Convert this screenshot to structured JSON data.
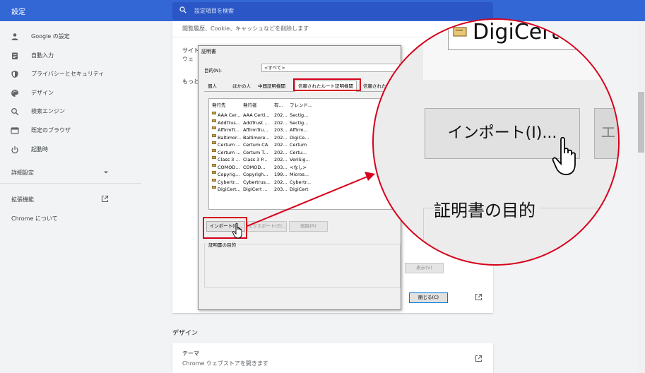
{
  "header": {
    "title": "設定",
    "search_placeholder": "設定項目を検索"
  },
  "sidebar": {
    "items": [
      {
        "icon": "person-icon",
        "label": "Google の設定"
      },
      {
        "icon": "assignment-icon",
        "label": "自動入力"
      },
      {
        "icon": "shield-icon",
        "label": "プライバシーとセキュリティ"
      },
      {
        "icon": "palette-icon",
        "label": "デザイン"
      },
      {
        "icon": "search-icon",
        "label": "検索エンジン"
      },
      {
        "icon": "browser-icon",
        "label": "既定のブラウザ"
      },
      {
        "icon": "power-icon",
        "label": "起動時"
      }
    ],
    "advanced": "詳細設定",
    "extensions": "拡張機能",
    "about": "Chrome について"
  },
  "main": {
    "clear_data_sub": "閲覧履歴、Cookie、キャッシュなどを削除します",
    "site_settings_partial": "サイト",
    "site_settings_sub_partial": "ウェ",
    "more_partial": "もっと",
    "design_heading": "デザイン",
    "theme_title": "テーマ",
    "theme_sub": "Chrome ウェブストアを開きます"
  },
  "dialog": {
    "title": "証明書",
    "purpose_label": "目的(N):",
    "purpose_value": "<すべて>",
    "tabs": [
      "個人",
      "ほかの人",
      "中間証明機関",
      "信頼されたルート証明機関",
      "信頼された"
    ],
    "columns": [
      "発行先",
      "発行者",
      "有...",
      "フレンド..."
    ],
    "rows": [
      [
        "AAA Cer...",
        "AAA Certi...",
        "202...",
        "Sectig..."
      ],
      [
        "AddTrus...",
        "AddTrust ...",
        "202...",
        "Sectig..."
      ],
      [
        "AffirmTr...",
        "AffirmTru...",
        "203...",
        "Affirm..."
      ],
      [
        "Baltimor...",
        "Baltimore...",
        "202...",
        "DigiCe..."
      ],
      [
        "Certum ...",
        "Certum CA",
        "202...",
        "Certum"
      ],
      [
        "Certum ...",
        "Certum T...",
        "202...",
        "Certu..."
      ],
      [
        "Class 3 ...",
        "Class 3 P...",
        "202...",
        "VeriSig..."
      ],
      [
        "COMOD...",
        "COMOD...",
        "203...",
        "<なし>"
      ],
      [
        "Copyrig...",
        "Copyrigh...",
        "199...",
        "Micros..."
      ],
      [
        "Cybertr...",
        "Cybertrus...",
        "202...",
        "Cybertr..."
      ],
      [
        "DigiCert...",
        "DigiCert ...",
        "203...",
        "DigiCert"
      ]
    ],
    "import_button": "インポート(I)...",
    "export_button": "エクスポート(E)...",
    "remove_button": "削除(R)",
    "cert_purpose_group": "証明書の目的",
    "view_button": "表示(V)",
    "close_button": "閉じる(C)"
  },
  "zoom": {
    "digicert_text": "DigiCert",
    "import_button": "インポート(I)...",
    "next_button_partial": "エ",
    "cert_purpose": "証明書の目的"
  },
  "colors": {
    "header_blue": "#3367d6",
    "highlight_red": "#d6001c"
  }
}
